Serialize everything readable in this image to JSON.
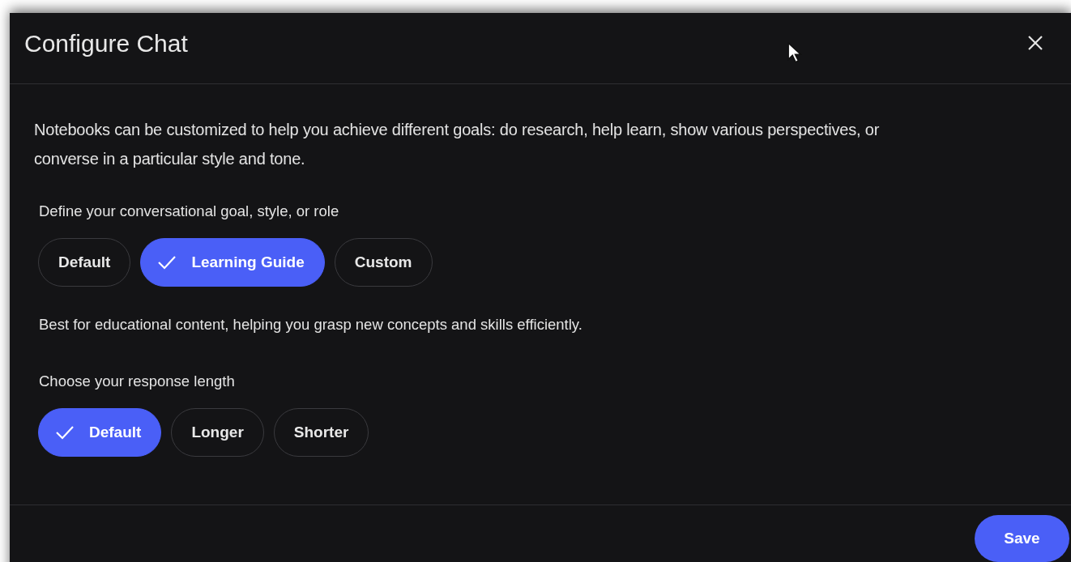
{
  "dialog": {
    "title": "Configure Chat"
  },
  "description": "Notebooks can be customized to help you achieve different goals: do research, help learn, show various perspectives, or converse in a particular style and tone.",
  "goal": {
    "label": "Define your conversational goal, style, or role",
    "options": [
      {
        "label": "Default",
        "selected": false
      },
      {
        "label": "Learning Guide",
        "selected": true
      },
      {
        "label": "Custom",
        "selected": false
      }
    ],
    "hint": "Best for educational content, helping you grasp new concepts and skills efficiently."
  },
  "length": {
    "label": "Choose your response length",
    "options": [
      {
        "label": "Default",
        "selected": true
      },
      {
        "label": "Longer",
        "selected": false
      },
      {
        "label": "Shorter",
        "selected": false
      }
    ]
  },
  "buttons": [
    "Save"
  ]
}
